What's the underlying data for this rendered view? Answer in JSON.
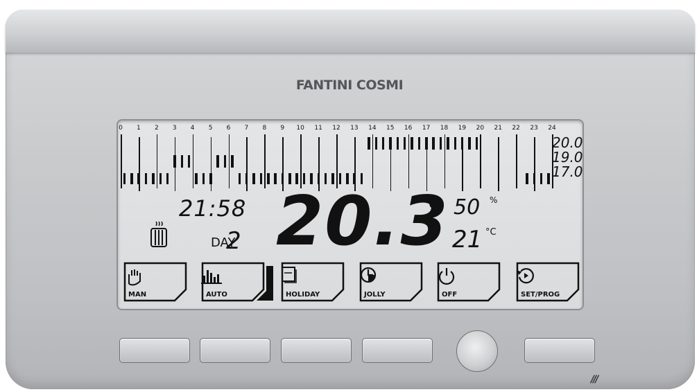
{
  "brand": "FANTINI COSMI",
  "hours": [
    "0",
    "1",
    "2",
    "3",
    "4",
    "5",
    "6",
    "7",
    "8",
    "9",
    "10",
    "11",
    "12",
    "13",
    "14",
    "15",
    "16",
    "17",
    "18",
    "19",
    "20",
    "21",
    "22",
    "23",
    "24"
  ],
  "program_levels": [
    1,
    1,
    1,
    1,
    1,
    1,
    1,
    2,
    2,
    2,
    1,
    1,
    1,
    2,
    2,
    2,
    1,
    1,
    1,
    1,
    1,
    1,
    1,
    1,
    1,
    1,
    1,
    1,
    1,
    1,
    1,
    1,
    1,
    1,
    3,
    3,
    3,
    3,
    3,
    3,
    3,
    3,
    3,
    3,
    3,
    3,
    3,
    3,
    3,
    3,
    0,
    0,
    0,
    0,
    0,
    0,
    1,
    1,
    1,
    1
  ],
  "scale": [
    "20.0",
    "19.0",
    "17.0"
  ],
  "display": {
    "clock": "21:58",
    "day_label": "DAY",
    "day_number": "2",
    "temperature": "20.3",
    "temp_unit": "°C",
    "humidity": "50",
    "humidity_unit": "%",
    "setpoint": "21",
    "setpoint_unit": "°C"
  },
  "modes": [
    {
      "label": "MAN",
      "icon": "hand-icon"
    },
    {
      "label": "AUTO",
      "icon": "bars-icon"
    },
    {
      "label": "HOLIDAY",
      "icon": "calendar-icon"
    },
    {
      "label": "JOLLY",
      "icon": "clock-icon"
    },
    {
      "label": "OFF",
      "icon": "power-icon"
    },
    {
      "label": "SET/PROG",
      "icon": "cycle-icon"
    }
  ],
  "vent_mark": "///"
}
